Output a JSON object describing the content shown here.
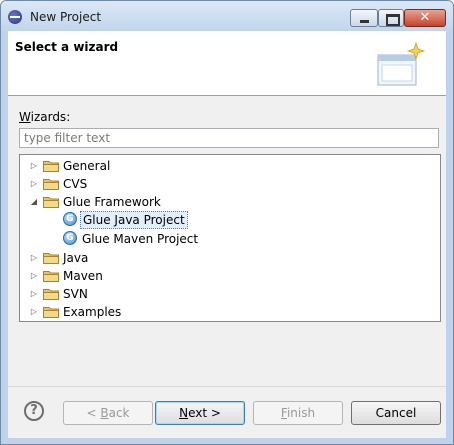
{
  "window": {
    "title": "New Project",
    "close_glyph": "✕"
  },
  "header": {
    "title": "Select a wizard"
  },
  "wizards": {
    "label_prefix": "W",
    "label_rest": "izards:",
    "filter_placeholder": "type filter text",
    "filter_value": ""
  },
  "tree": {
    "expanded_twisty": "◢",
    "collapsed_twisty": "▷",
    "items": [
      {
        "label": "General"
      },
      {
        "label": "CVS"
      },
      {
        "label": "Glue Framework",
        "expanded": true,
        "children": [
          {
            "label": "Glue Java Project",
            "selected": true
          },
          {
            "label": "Glue Maven Project"
          }
        ]
      },
      {
        "label": "Java"
      },
      {
        "label": "Maven"
      },
      {
        "label": "SVN"
      },
      {
        "label": "Examples"
      }
    ],
    "project_icon_letter": "G"
  },
  "buttons": {
    "help_glyph": "?",
    "back": {
      "mnemonic": "< ",
      "u": "B",
      "rest": "ack",
      "enabled": false
    },
    "next": {
      "mnemonic": "",
      "u": "N",
      "rest": "ext >",
      "enabled": true
    },
    "finish": {
      "mnemonic": "",
      "u": "F",
      "rest": "inish",
      "enabled": false
    },
    "cancel": {
      "label": "Cancel",
      "enabled": true
    }
  },
  "colors": {
    "folder": "#e8c56a",
    "accent": "#3c7fb1"
  }
}
